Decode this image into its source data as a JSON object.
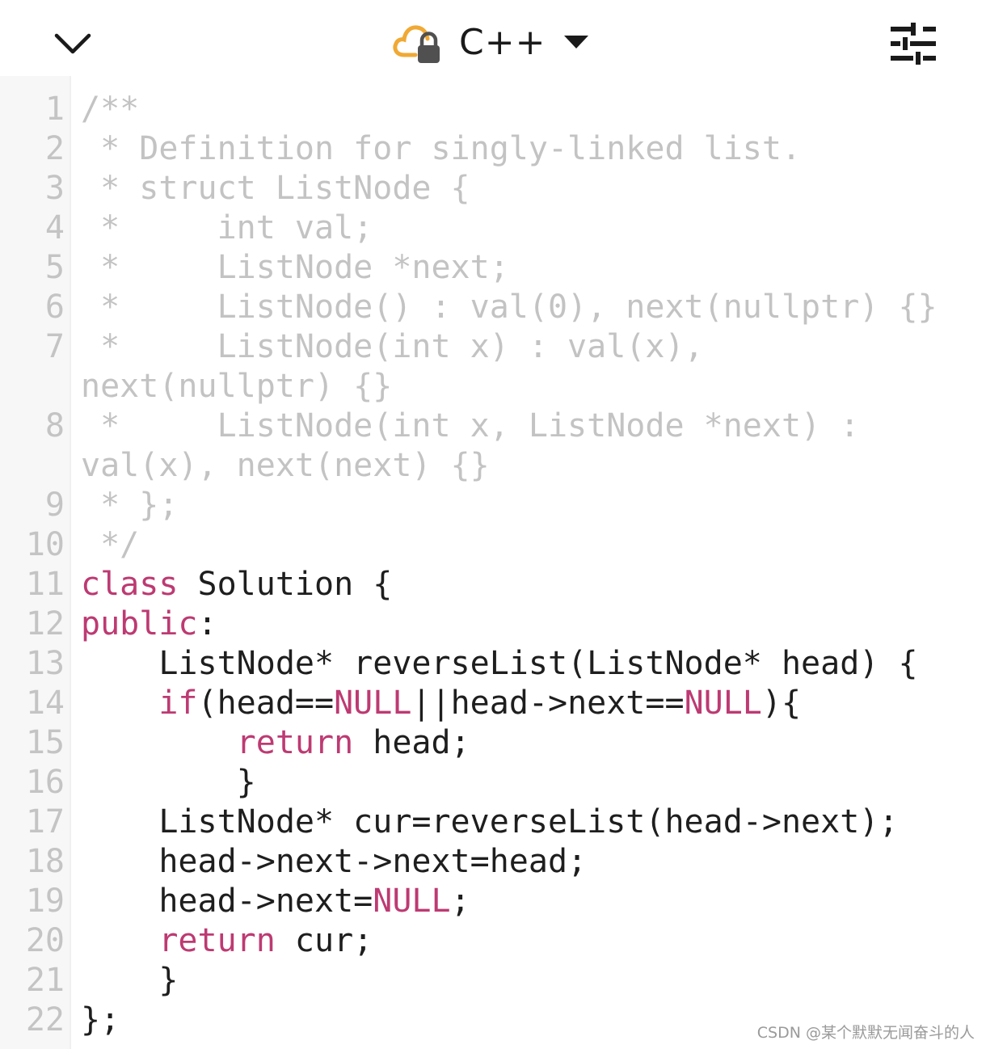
{
  "header": {
    "language": "C++",
    "icons": {
      "collapse": "chevron-down-icon",
      "cloud_lock": "cloud-lock-icon",
      "caret": "caret-down-icon",
      "settings": "sliders-icon"
    },
    "cloud_color": "#f0a934"
  },
  "editor": {
    "colors": {
      "comment": "#c3c3c3",
      "keyword": "#bd3a72",
      "text": "#1e1e1e",
      "line_number": "#c4c4c4"
    },
    "lines": [
      {
        "num": "1",
        "rows": [
          [
            [
              "cm",
              "/**"
            ]
          ]
        ]
      },
      {
        "num": "2",
        "rows": [
          [
            [
              "cm",
              " * Definition for singly-linked list."
            ]
          ]
        ]
      },
      {
        "num": "3",
        "rows": [
          [
            [
              "cm",
              " * struct ListNode {"
            ]
          ]
        ]
      },
      {
        "num": "4",
        "rows": [
          [
            [
              "cm",
              " *     int val;"
            ]
          ]
        ]
      },
      {
        "num": "5",
        "rows": [
          [
            [
              "cm",
              " *     ListNode *next;"
            ]
          ]
        ]
      },
      {
        "num": "6",
        "rows": [
          [
            [
              "cm",
              " *     ListNode() : val(0), next(nullptr) {}"
            ]
          ]
        ]
      },
      {
        "num": "7",
        "rows": [
          [
            [
              "cm",
              " *     ListNode(int x) : val(x),"
            ]
          ],
          [
            [
              "cm",
              "next(nullptr) {}"
            ]
          ]
        ]
      },
      {
        "num": "8",
        "rows": [
          [
            [
              "cm",
              " *     ListNode(int x, ListNode *next) :"
            ]
          ],
          [
            [
              "cm",
              "val(x), next(next) {}"
            ]
          ]
        ]
      },
      {
        "num": "9",
        "rows": [
          [
            [
              "cm",
              " * };"
            ]
          ]
        ]
      },
      {
        "num": "10",
        "rows": [
          [
            [
              "cm",
              " */"
            ]
          ]
        ]
      },
      {
        "num": "11",
        "rows": [
          [
            [
              "kw",
              "class"
            ],
            [
              "",
              " Solution {"
            ]
          ]
        ]
      },
      {
        "num": "12",
        "rows": [
          [
            [
              "kw",
              "public"
            ],
            [
              "",
              ":"
            ]
          ]
        ]
      },
      {
        "num": "13",
        "rows": [
          [
            [
              "",
              "    ListNode* reverseList(ListNode* head) {"
            ]
          ]
        ]
      },
      {
        "num": "14",
        "rows": [
          [
            [
              "",
              "    "
            ],
            [
              "kw",
              "if"
            ],
            [
              "",
              "(head=="
            ],
            [
              "kw",
              "NULL"
            ],
            [
              "",
              "||head->next=="
            ],
            [
              "kw",
              "NULL"
            ],
            [
              "",
              "){"
            ]
          ]
        ]
      },
      {
        "num": "15",
        "rows": [
          [
            [
              "",
              "        "
            ],
            [
              "kw",
              "return"
            ],
            [
              "",
              " head;"
            ]
          ]
        ]
      },
      {
        "num": "16",
        "rows": [
          [
            [
              "",
              "        }"
            ]
          ]
        ]
      },
      {
        "num": "17",
        "rows": [
          [
            [
              "",
              "    ListNode* cur=reverseList(head->next);"
            ]
          ]
        ]
      },
      {
        "num": "18",
        "rows": [
          [
            [
              "",
              "    head->next->next=head;"
            ]
          ]
        ]
      },
      {
        "num": "19",
        "rows": [
          [
            [
              "",
              "    head->next="
            ],
            [
              "kw",
              "NULL"
            ],
            [
              "",
              ";"
            ]
          ]
        ]
      },
      {
        "num": "20",
        "rows": [
          [
            [
              "",
              "    "
            ],
            [
              "kw",
              "return"
            ],
            [
              "",
              " cur;"
            ]
          ]
        ]
      },
      {
        "num": "21",
        "rows": [
          [
            [
              "",
              "    }"
            ]
          ]
        ]
      },
      {
        "num": "22",
        "rows": [
          [
            [
              "",
              "};"
            ]
          ]
        ]
      }
    ]
  },
  "watermark": "CSDN @某个默默无闻奋斗的人"
}
